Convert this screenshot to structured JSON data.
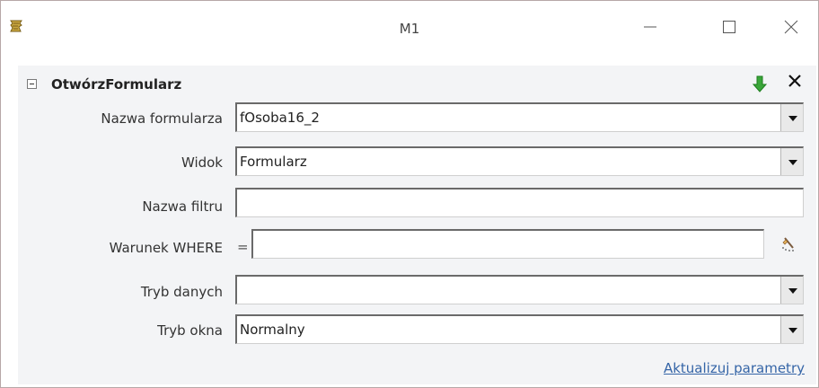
{
  "window": {
    "title": "M1",
    "controls": {
      "minimize": "—",
      "maximize": "☐",
      "close": "✕"
    }
  },
  "action": {
    "name": "OtwórzFormularz",
    "icons": {
      "collapse": "minus-box-icon",
      "move_down": "green-down-arrow-icon",
      "delete": "x-icon",
      "builder": "builder-wand-icon"
    }
  },
  "fields": {
    "form_name": {
      "label": "Nazwa formularza",
      "value": "fOsoba16_2"
    },
    "view": {
      "label": "Widok",
      "value": "Formularz"
    },
    "filter_name": {
      "label": "Nazwa filtru",
      "value": ""
    },
    "where_condition": {
      "label": "Warunek WHERE",
      "prefix": "=",
      "value": ""
    },
    "data_mode": {
      "label": "Tryb danych",
      "value": ""
    },
    "window_mode": {
      "label": "Tryb okna",
      "value": "Normalny"
    }
  },
  "links": {
    "update_parameters": "Aktualizuj parametry"
  },
  "colors": {
    "panel_background": "#f3f4f6",
    "window_border": "#b7a7a7",
    "link": "#3565a7",
    "move_down_arrow": "#3aa63a"
  }
}
